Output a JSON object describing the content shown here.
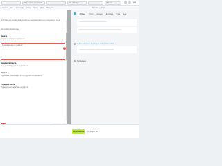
{
  "topbar": {
    "fields": [
      "",
      "Подписание документов",
      "",
      "Кто-то создан",
      "",
      "Условия"
    ],
    "more_label": "Ещё"
  },
  "tabs_row": {
    "items": [
      "Задачи",
      "Чат",
      "Календарь",
      "Файлы",
      "Лента",
      "Диск",
      "Процессы",
      "Виджет",
      "Ещё"
    ]
  },
  "modal": {
    "title": "",
    "blocks": [
      {
        "title": "",
        "desc": "Действие для автоматизации работы с документами и его следующего шага"
      },
      {
        "title": "",
        "desc": "Настройка параметров"
      },
      {
        "title": "Задача",
        "desc": "Создание задачи по документу"
      },
      {
        "title": "",
        "desc": "Рекомендации по подписи"
      },
      {
        "title": "Ожидание ответа",
        "desc": "Передать сотрудникам подписания"
      },
      {
        "title": "Запрос",
        "desc": "Получение информации от сотрудников по документу"
      },
      {
        "title": "Создание карты",
        "desc": "Управление элементами маршрута"
      }
    ],
    "marker_1": "1",
    "marker_2": "2",
    "ok_label": "OK",
    "footer_link": "СБРОСИТЬ ДЕЙСТВИЕ"
  },
  "right_panel": {
    "tabs": [
      "Общие",
      "Поля",
      "Документ",
      "Действия",
      "Роли",
      "Ещё"
    ],
    "note": "Шаг не настроен. Перейдите к настройке этапа.",
    "card_text": "Нет данных"
  },
  "bottom": {
    "save_label": "СОХРАНИТЬ",
    "cancel_label": "ОТМЕНИТЬ"
  },
  "colors": {
    "accent_red": "#e2605c",
    "accent_green": "#bbed21",
    "link_blue": "#2fa4d8"
  }
}
